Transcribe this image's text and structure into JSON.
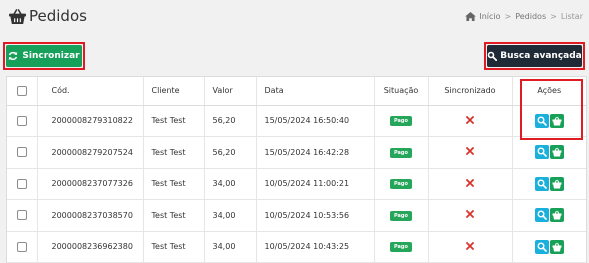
{
  "header": {
    "title": "Pedidos",
    "breadcrumb": [
      "Início",
      "Pedidos",
      "Listar"
    ],
    "breadcrumb_sep": ">"
  },
  "toolbar": {
    "sync_label": "Sincronizar",
    "search_label": "Busca avançada"
  },
  "table": {
    "columns": [
      "Cód.",
      "Cliente",
      "Valor",
      "Data",
      "Situação",
      "Sincronizado",
      "Ações"
    ],
    "rows": [
      {
        "cod": "2000008279310822",
        "cliente": "Test Test",
        "valor": "56,20",
        "data": "15/05/2024 16:50:40",
        "situacao": "Pago"
      },
      {
        "cod": "2000008279207524",
        "cliente": "Test Test",
        "valor": "56,20",
        "data": "15/05/2024 16:42:28",
        "situacao": "Pago"
      },
      {
        "cod": "2000008237077326",
        "cliente": "Test Test",
        "valor": "34,00",
        "data": "10/05/2024 11:00:21",
        "situacao": "Pago"
      },
      {
        "cod": "2000008237038570",
        "cliente": "Test Test",
        "valor": "34,00",
        "data": "10/05/2024 10:53:56",
        "situacao": "Pago"
      },
      {
        "cod": "2000008236962380",
        "cliente": "Test Test",
        "valor": "34,00",
        "data": "10/05/2024 10:43:25",
        "situacao": "Pago"
      }
    ]
  },
  "icons": {
    "title": "basket-icon",
    "breadcrumb": "home-icon",
    "sync": "refresh-icon",
    "search": "zoom-icon",
    "not_synced": "x-icon",
    "view": "search-icon",
    "cart": "basket-icon"
  },
  "colors": {
    "sync_button": "#17a05a",
    "search_button": "#1f2a36",
    "badge_pago": "#26a65b",
    "not_synced": "#d9342b",
    "view_button": "#1ab0dc",
    "cart_button": "#18a058",
    "highlight": "#e11b22"
  }
}
